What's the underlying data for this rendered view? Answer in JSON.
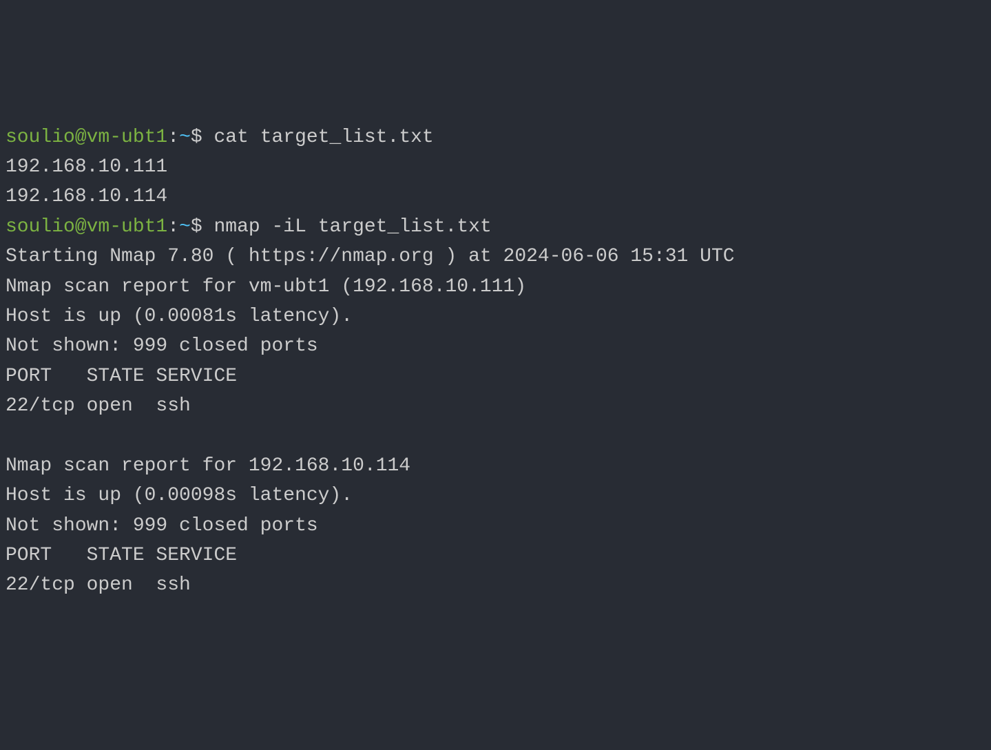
{
  "prompt": {
    "user_host": "soulio@vm-ubt1",
    "colon": ":",
    "path": "~",
    "dollar": "$ "
  },
  "session": [
    {
      "type": "prompt",
      "command": "cat target_list.txt"
    },
    {
      "type": "output",
      "text": "192.168.10.111"
    },
    {
      "type": "output",
      "text": "192.168.10.114"
    },
    {
      "type": "prompt",
      "command": "nmap -iL target_list.txt"
    },
    {
      "type": "output",
      "text": "Starting Nmap 7.80 ( https://nmap.org ) at 2024-06-06 15:31 UTC"
    },
    {
      "type": "output",
      "text": "Nmap scan report for vm-ubt1 (192.168.10.111)"
    },
    {
      "type": "output",
      "text": "Host is up (0.00081s latency)."
    },
    {
      "type": "output",
      "text": "Not shown: 999 closed ports"
    },
    {
      "type": "output",
      "text": "PORT   STATE SERVICE"
    },
    {
      "type": "output",
      "text": "22/tcp open  ssh"
    },
    {
      "type": "output",
      "text": ""
    },
    {
      "type": "output",
      "text": "Nmap scan report for 192.168.10.114"
    },
    {
      "type": "output",
      "text": "Host is up (0.00098s latency)."
    },
    {
      "type": "output",
      "text": "Not shown: 999 closed ports"
    },
    {
      "type": "output",
      "text": "PORT   STATE SERVICE"
    },
    {
      "type": "output",
      "text": "22/tcp open  ssh"
    }
  ]
}
